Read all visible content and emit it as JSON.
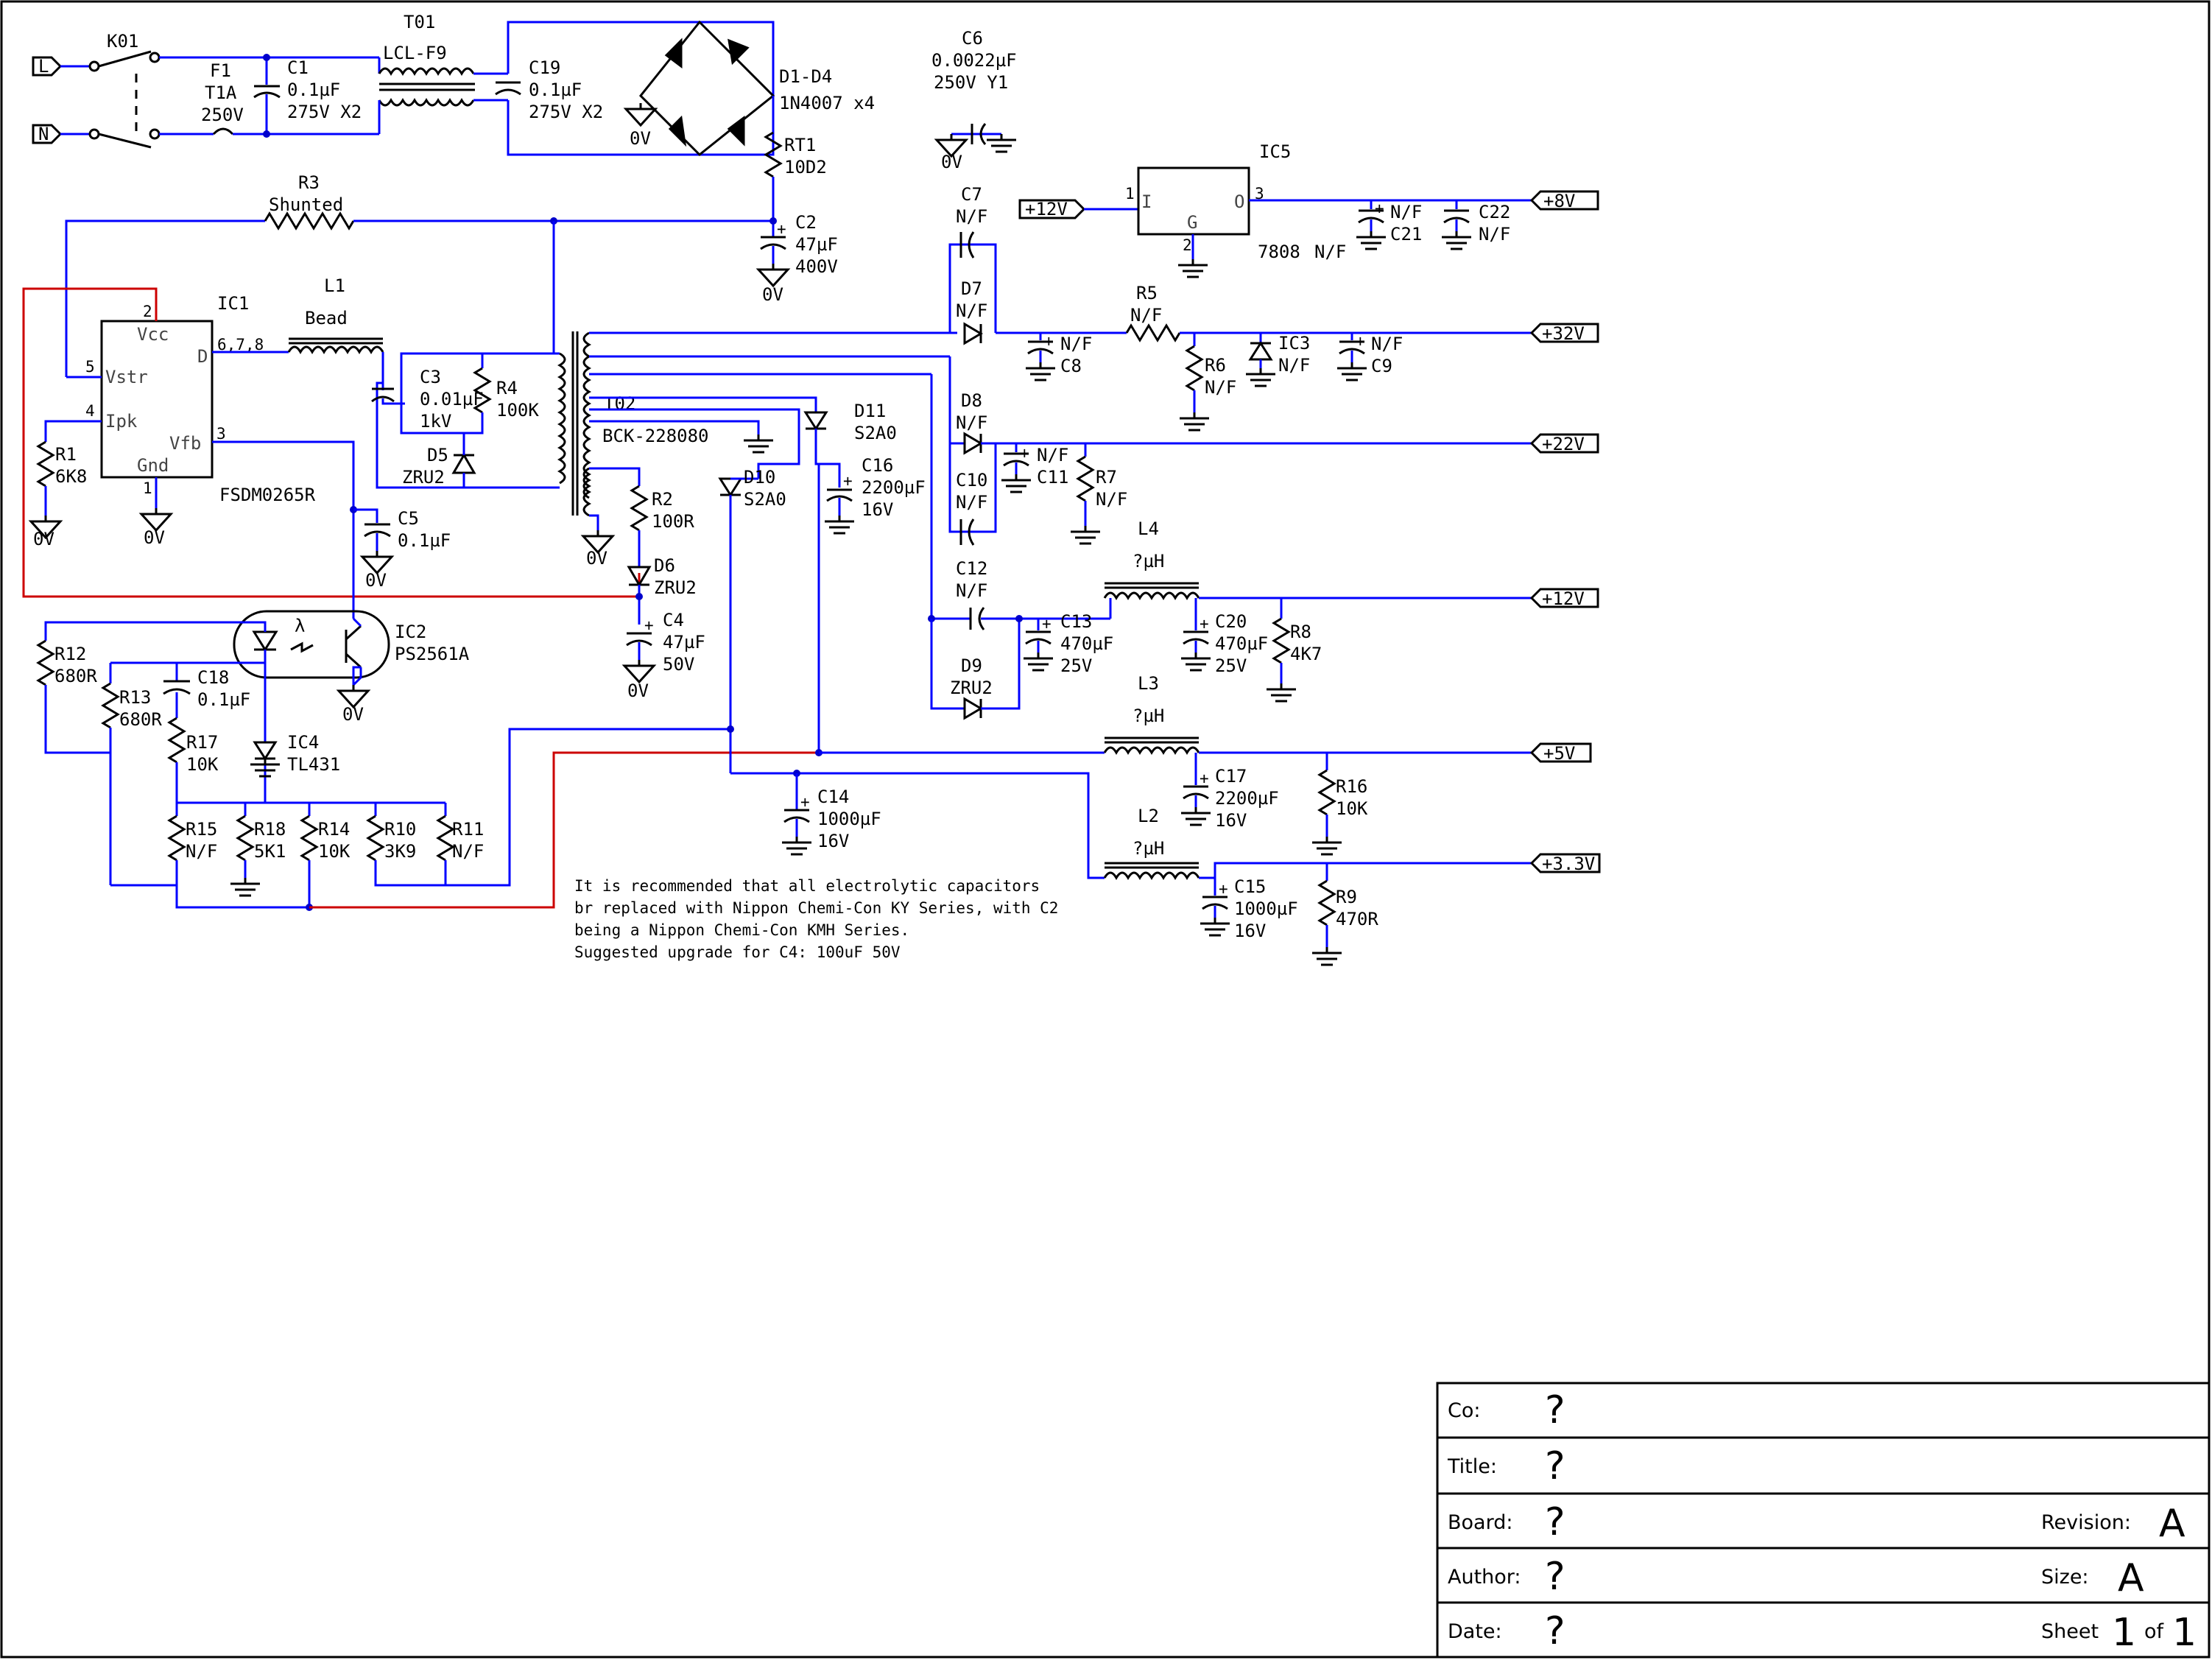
{
  "components": {
    "k01": "K01",
    "l_term": "L",
    "n_term": "N",
    "f1": "F1",
    "f1_val": "T1A",
    "f1_v": "250V",
    "c1": "C1",
    "c1_val": "0.1µF",
    "c1_v": "275V X2",
    "t01": "T01",
    "t01_val": "LCL-F9",
    "c19": "C19",
    "c19_val": "0.1µF",
    "c19_v": "275V X2",
    "d1d4": "D1-D4",
    "d1d4_val": "1N4007 x4",
    "rt1": "RT1",
    "rt1_val": "10D2",
    "c6": "C6",
    "c6_val": "0.0022µF",
    "c6_v": "250V Y1",
    "r3": "R3",
    "r3_val": "Shunted",
    "c2": "C2",
    "c2_val": "47µF",
    "c2_v": "400V",
    "ic1": "IC1",
    "ic1_part": "FSDM0265R",
    "ic1_vcc": "Vcc",
    "ic1_d": "D",
    "ic1_vstr": "Vstr",
    "ic1_ipk": "Ipk",
    "ic1_vfb": "Vfb",
    "ic1_gnd": "Gnd",
    "ic1_pin2": "2",
    "ic1_pin5": "5",
    "ic1_pin4": "4",
    "ic1_pin3": "3",
    "ic1_pin1": "1",
    "ic1_pin678": "6,7,8",
    "l1": "L1",
    "l1_val": "Bead",
    "c3": "C3",
    "c3_val": "0.01µF",
    "c3_v": "1kV",
    "r4": "R4",
    "r4_val": "100K",
    "d5": "D5",
    "d5_val": "ZRU2",
    "t02": "T02",
    "t02_val": "BCK-228080",
    "r1": "R1",
    "r1_val": "6K8",
    "c5": "C5",
    "c5_val": "0.1µF",
    "r2": "R2",
    "r2_val": "100R",
    "d6": "D6",
    "d6_val": "ZRU2",
    "c4": "C4",
    "c4_val": "47µF",
    "c4_v": "50V",
    "ic2": "IC2",
    "ic2_part": "PS2561A",
    "lambda": "λ",
    "r12": "R12",
    "r12_val": "680R",
    "r13": "R13",
    "r13_val": "680R",
    "c18": "C18",
    "c18_val": "0.1µF",
    "r17": "R17",
    "r17_val": "10K",
    "ic4": "IC4",
    "ic4_part": "TL431",
    "r15": "R15",
    "r15_val": "N/F",
    "r18": "R18",
    "r18_val": "5K1",
    "r14": "R14",
    "r14_val": "10K",
    "r10": "R10",
    "r10_val": "3K9",
    "r11": "R11",
    "r11_val": "N/F",
    "d10": "D10",
    "d10_val": "S2A0",
    "d11": "D11",
    "d11_val": "S2A0",
    "c16": "C16",
    "c16_val": "2200µF",
    "c16_v": "16V",
    "c14": "C14",
    "c14_val": "1000µF",
    "c14_v": "16V",
    "c7": "C7",
    "c7_val": "N/F",
    "d7": "D7",
    "d7_val": "N/F",
    "c8": "C8",
    "c8_val": "N/F",
    "r5": "R5",
    "r5_val": "N/F",
    "r6": "R6",
    "r6_val": "N/F",
    "ic3": "IC3",
    "ic3_val": "N/F",
    "c9": "C9",
    "c9_val": "N/F",
    "d8": "D8",
    "d8_val": "N/F",
    "c11": "C11",
    "c11_val": "N/F",
    "r7": "R7",
    "r7_val": "N/F",
    "c10": "C10",
    "c10_val": "N/F",
    "l4": "L4",
    "l4_val": "?µH",
    "c12": "C12",
    "c12_val": "N/F",
    "c13": "C13",
    "c13_val": "470µF",
    "c13_v": "25V",
    "c20": "C20",
    "c20_val": "470µF",
    "c20_v": "25V",
    "r8": "R8",
    "r8_val": "4K7",
    "d9": "D9",
    "d9_val": "ZRU2",
    "l3": "L3",
    "l3_val": "?µH",
    "c17": "C17",
    "c17_val": "2200µF",
    "c17_v": "16V",
    "r16": "R16",
    "r16_val": "10K",
    "l2": "L2",
    "l2_val": "?µH",
    "c15": "C15",
    "c15_val": "1000µF",
    "c15_v": "16V",
    "r9": "R9",
    "r9_val": "470R",
    "ic5": "IC5",
    "ic5_part": "7808",
    "ic5_val": "N/F",
    "ic5_i": "I",
    "ic5_o": "O",
    "ic5_g": "G",
    "ic5_pin1": "1",
    "ic5_pin2": "2",
    "ic5_pin3": "3",
    "c21": "C21",
    "c21_val": "N/F",
    "c22": "C22",
    "c22_val": "N/F",
    "gnd": "0V"
  },
  "ports": {
    "p32": "+32V",
    "p22": "+22V",
    "p12": "+12V",
    "p5": "+5V",
    "p33": "+3.3V",
    "p8": "+8V",
    "p12in": "+12V"
  },
  "note": {
    "line1": "It is recommended that all electrolytic capacitors",
    "line2": "br replaced with Nippon Chemi-Con KY Series, with C2",
    "line3": "being a Nippon Chemi-Con KMH Series.",
    "line4": "Suggested upgrade for C4: 100uF 50V"
  },
  "title_block": {
    "co_label": "Co:",
    "co_val": "?",
    "title_label": "Title:",
    "title_val": "?",
    "board_label": "Board:",
    "board_val": "?",
    "revision_label": "Revision:",
    "revision_val": "A",
    "author_label": "Author:",
    "author_val": "?",
    "size_label": "Size:",
    "size_val": "A",
    "date_label": "Date:",
    "date_val": "?",
    "sheet_label": "Sheet",
    "sheet_val": "1",
    "of_label": "of",
    "of_val": "1"
  },
  "colors": {
    "wire": "#0000ff",
    "wire_red": "#cc0000",
    "symbol": "#000000"
  }
}
